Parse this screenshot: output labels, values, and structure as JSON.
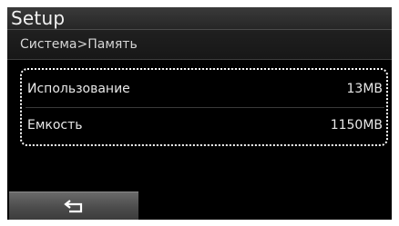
{
  "header": {
    "title": "Setup"
  },
  "breadcrumb": {
    "text": "Система>Память"
  },
  "memory": {
    "rows": [
      {
        "label": "Использование",
        "value": "13MB"
      },
      {
        "label": "Емкость",
        "value": "1150MB"
      }
    ]
  },
  "footer": {
    "back_icon": "return-arrow-icon"
  },
  "colors": {
    "background": "#000000",
    "text": "#e8e8e8",
    "focus_outline": "#ffffff",
    "button": "#4c4c4c"
  }
}
